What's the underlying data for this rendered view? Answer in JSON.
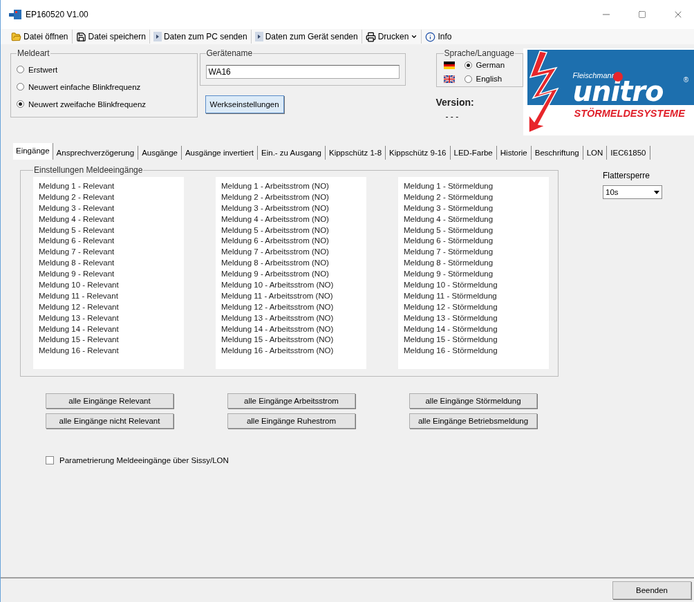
{
  "window": {
    "title": "EP160520 V1.00"
  },
  "toolbar": [
    {
      "label": "Datei öffnen",
      "kind": "open",
      "dropdown": false
    },
    {
      "label": "Datei speichern",
      "kind": "save",
      "dropdown": false
    },
    {
      "label": "Daten zum PC senden",
      "kind": "send",
      "dropdown": false
    },
    {
      "label": "Daten zum Gerät senden",
      "kind": "send",
      "dropdown": false
    },
    {
      "label": "Drucken",
      "kind": "print",
      "dropdown": true
    },
    {
      "label": "Info",
      "kind": "info",
      "dropdown": false
    }
  ],
  "meldeart": {
    "title": "Meldeart",
    "options": [
      {
        "label": "Erstwert",
        "selected": false
      },
      {
        "label": "Neuwert einfache Blinkfrequenz",
        "selected": false
      },
      {
        "label": "Neuwert zweifache Blinkfrequenz",
        "selected": true
      }
    ]
  },
  "geraetename": {
    "title": "Gerätename",
    "value": "WA16"
  },
  "factory_button": "Werkseinstellungen",
  "language": {
    "title": "Sprache/Language",
    "options": [
      {
        "label": "German",
        "kind": "de",
        "selected": true
      },
      {
        "label": "English",
        "kind": "uk",
        "selected": false
      }
    ]
  },
  "version": {
    "label": "Version:",
    "value": "- - -"
  },
  "logo": {
    "maker": "Fleischmann",
    "brand": "unitro",
    "mark": "®",
    "tagline": "STÖRMELDESYSTEME"
  },
  "tabs": [
    {
      "label": "Eingänge",
      "selected": true
    },
    {
      "label": "Ansprechverzögerung",
      "selected": false
    },
    {
      "label": "Ausgänge",
      "selected": false
    },
    {
      "label": "Ausgänge invertiert",
      "selected": false
    },
    {
      "label": "Ein.- zu Ausgang",
      "selected": false
    },
    {
      "label": "Kippschütz 1-8",
      "selected": false
    },
    {
      "label": "Kippschütz 9-16",
      "selected": false
    },
    {
      "label": "LED-Farbe",
      "selected": false
    },
    {
      "label": "Historie",
      "selected": false
    },
    {
      "label": "Beschriftung",
      "selected": false
    },
    {
      "label": "LON",
      "selected": false
    },
    {
      "label": "IEC61850",
      "selected": false
    }
  ],
  "inputs": {
    "title": "Einstellungen Meldeeingänge",
    "lists": [
      [
        "Meldung 1 - Relevant",
        "Meldung 2 - Relevant",
        "Meldung 3 - Relevant",
        "Meldung 4 - Relevant",
        "Meldung 5 - Relevant",
        "Meldung 6 - Relevant",
        "Meldung 7 - Relevant",
        "Meldung 8 - Relevant",
        "Meldung 9 - Relevant",
        "Meldung 10 - Relevant",
        "Meldung 11 - Relevant",
        "Meldung 12 - Relevant",
        "Meldung 13 - Relevant",
        "Meldung 14 - Relevant",
        "Meldung 15 - Relevant",
        "Meldung 16 - Relevant"
      ],
      [
        "Meldung 1 - Arbeitsstrom (NO)",
        "Meldung 2 - Arbeitsstrom (NO)",
        "Meldung 3 - Arbeitsstrom (NO)",
        "Meldung 4 - Arbeitsstrom (NO)",
        "Meldung 5 - Arbeitsstrom (NO)",
        "Meldung 6 - Arbeitsstrom (NO)",
        "Meldung 7 - Arbeitsstrom (NO)",
        "Meldung 8 - Arbeitsstrom (NO)",
        "Meldung 9 - Arbeitsstrom (NO)",
        "Meldung 10 - Arbeitsstrom (NO)",
        "Meldung 11 - Arbeitsstrom (NO)",
        "Meldung 12 - Arbeitsstrom (NO)",
        "Meldung 13 - Arbeitsstrom (NO)",
        "Meldung 14 - Arbeitsstrom (NO)",
        "Meldung 15 - Arbeitsstrom (NO)",
        "Meldung 16 - Arbeitsstrom (NO)"
      ],
      [
        "Meldung 1 - Störmeldung",
        "Meldung 2 - Störmeldung",
        "Meldung 3 - Störmeldung",
        "Meldung 4 - Störmeldung",
        "Meldung 5 - Störmeldung",
        "Meldung 6 - Störmeldung",
        "Meldung 7 - Störmeldung",
        "Meldung 8 - Störmeldung",
        "Meldung 9 - Störmeldung",
        "Meldung 10 - Störmeldung",
        "Meldung 11 - Störmeldung",
        "Meldung 12 - Störmeldung",
        "Meldung 13 - Störmeldung",
        "Meldung 14 - Störmeldung",
        "Meldung 15 - Störmeldung",
        "Meldung 16 - Störmeldung"
      ]
    ]
  },
  "flattersperre": {
    "label": "Flattersperre",
    "value": "10s"
  },
  "buttons": [
    [
      "alle Eingänge Relevant",
      "alle Eingänge nicht Relevant"
    ],
    [
      "alle Eingänge Arbeitsstrom",
      "alle Eingänge Ruhestrom"
    ],
    [
      "alle Eingänge Störmeldung",
      "alle Eingänge Betriebsmeldung"
    ]
  ],
  "sissy": {
    "label": "Parametrierung Meldeeingänge über Sissy/LON",
    "checked": false
  },
  "close_button": "Beenden"
}
